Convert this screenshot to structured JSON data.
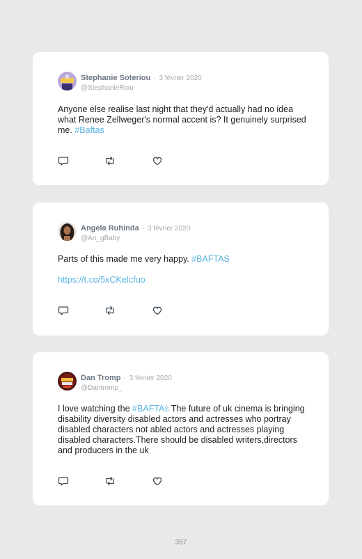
{
  "tweets": [
    {
      "name": "Stephanie Soteriou",
      "separator": "·",
      "date": "3 février 2020",
      "handle": "@StephanieRiou",
      "text_before": "Anyone else realise last night that they'd actually had no idea what Renee Zellweger's normal accent is? It genuinely surprised me. ",
      "hashtag": "#Baftas",
      "avatar_color": "#b9a7d9"
    },
    {
      "name": "Angela Ruhinda",
      "separator": "·",
      "date": "3 février 2020",
      "handle": "@An_gBaby",
      "text_before": "Parts of this made me very happy. ",
      "hashtag": "#BAFTAS",
      "url": "https://t.co/5xCKeIcfuo",
      "avatar_color": "#2a1c16"
    },
    {
      "name": "Dan Tromp",
      "separator": "·",
      "date": "3 février 2020",
      "handle": "@Dantromp_",
      "text_before": "I love watching the ",
      "hashtag": "#BAFTAs",
      "text_after": " The future of uk cinema is bringing disability diversity disabled actors and actresses who portray disabled characters not abled actors and actresses playing disabled characters.There should be disabled writers,directors and producers in the uk",
      "avatar_color": "#4a1410"
    }
  ],
  "actions": {
    "reply_icon": "reply-icon",
    "retweet_icon": "retweet-icon",
    "like_icon": "heart-icon"
  },
  "colors": {
    "link": "#5bb5e3",
    "background": "#e9e9e9",
    "card": "#ffffff"
  },
  "page_number": "357"
}
